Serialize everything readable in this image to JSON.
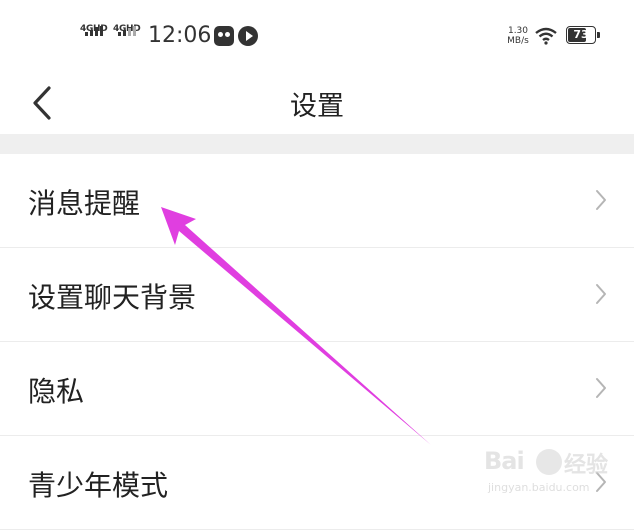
{
  "status_bar": {
    "signal1_label": "4GHD",
    "signal2_label": "4GHD",
    "time": "12:06",
    "net_speed_value": "1.30",
    "net_speed_unit": "MB/s",
    "battery": "73",
    "battery_level": 0.73
  },
  "nav": {
    "title": "设置"
  },
  "settings": {
    "items": [
      {
        "label": "消息提醒"
      },
      {
        "label": "设置聊天背景"
      },
      {
        "label": "隐私"
      },
      {
        "label": "青少年模式"
      }
    ]
  },
  "watermark": {
    "brand": "Bai",
    "brand_cn": "经验",
    "url": "jingyan.baidu.com"
  },
  "colors": {
    "annotation_arrow": "#e03ee0",
    "separator": "#efefef",
    "chevron": "#b5b5b5"
  }
}
